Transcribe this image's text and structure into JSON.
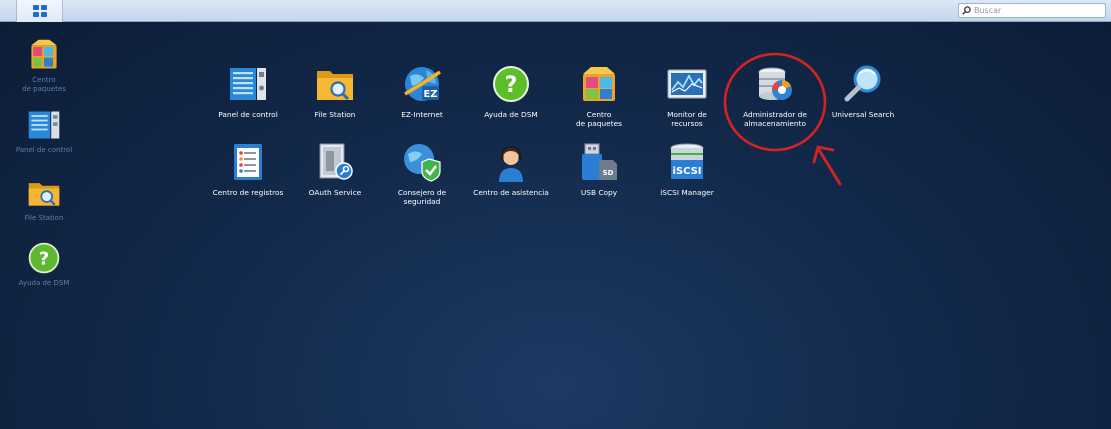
{
  "taskbar": {
    "menu_icon": "grid-icon",
    "search_placeholder": "Buscar",
    "search_icon": "search-icon"
  },
  "desktop": [
    {
      "label": "Centro\nde paquetes",
      "icon": "package-center-icon"
    },
    {
      "label": "Panel de control",
      "icon": "control-panel-icon"
    },
    {
      "label": "File Station",
      "icon": "folder-icon"
    },
    {
      "label": "Ayuda de DSM",
      "icon": "help-icon"
    }
  ],
  "apps": [
    {
      "label": "Panel de control",
      "icon": "control-panel-icon"
    },
    {
      "label": "File Station",
      "icon": "folder-search-icon"
    },
    {
      "label": "EZ-Internet",
      "icon": "globe-ez-icon"
    },
    {
      "label": "Ayuda de DSM",
      "icon": "help-icon"
    },
    {
      "label": "Centro\nde paquetes",
      "icon": "package-center-icon"
    },
    {
      "label": "Monitor de\nrecursos",
      "icon": "resource-monitor-icon"
    },
    {
      "label": "Administrador de\nalmacenamiento",
      "icon": "storage-manager-icon"
    },
    {
      "label": "Universal Search",
      "icon": "magnifier-icon"
    },
    {
      "label": "Centro de registros",
      "icon": "log-center-icon"
    },
    {
      "label": "OAuth Service",
      "icon": "oauth-icon"
    },
    {
      "label": "Consejero de\nseguridad",
      "icon": "security-shield-icon"
    },
    {
      "label": "Centro de asistencia",
      "icon": "support-agent-icon"
    },
    {
      "label": "USB Copy",
      "icon": "usb-sd-icon"
    },
    {
      "label": "iSCSI Manager",
      "icon": "iscsi-icon"
    }
  ],
  "iscsi_badge": "iSCSI",
  "sd_badge": "SD",
  "ez_badge": "EZ",
  "annotation": {
    "color": "#d42323",
    "highlight": "Administrador de\nalmacenamiento"
  }
}
